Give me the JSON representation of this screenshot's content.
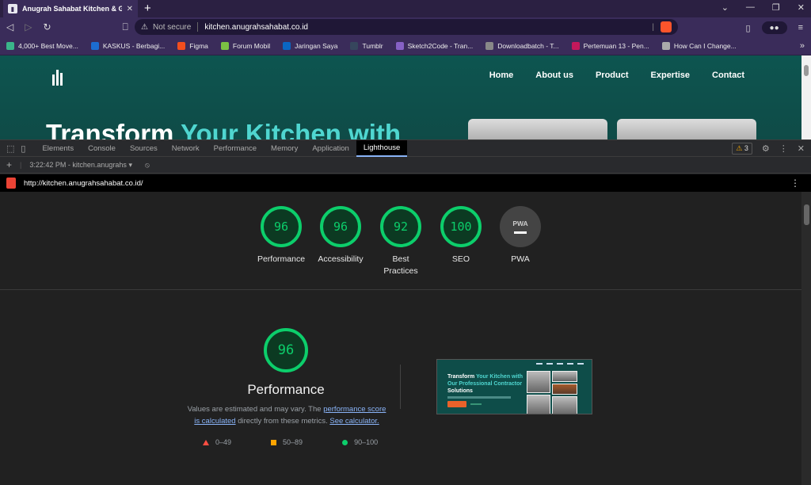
{
  "browser": {
    "tab_title": "Anugrah Sahabat Kitchen & Gas",
    "not_secure": "Not secure",
    "url": "kitchen.anugrahsahabat.co.id",
    "bookmarks": [
      {
        "label": "4,000+ Best Move...",
        "color": "#3ab58a"
      },
      {
        "label": "KASKUS - Berbagi...",
        "color": "#1c6dd0"
      },
      {
        "label": "Figma",
        "color": "#f24e1e"
      },
      {
        "label": "Forum Mobil",
        "color": "#7bc043"
      },
      {
        "label": "Jaringan Saya",
        "color": "#0a66c2"
      },
      {
        "label": "Tumblr",
        "color": "#36465d"
      },
      {
        "label": "Sketch2Code - Tran...",
        "color": "#8661c5"
      },
      {
        "label": "Downloadbatch - T...",
        "color": "#888888"
      },
      {
        "label": "Pertemuan 13 - Pen...",
        "color": "#c2185b"
      },
      {
        "label": "How Can I Change...",
        "color": "#aaaaaa"
      }
    ]
  },
  "site": {
    "nav": [
      "Home",
      "About us",
      "Product",
      "Expertise",
      "Contact"
    ],
    "hero_white": "Transform ",
    "hero_accent": "Your Kitchen with"
  },
  "devtools": {
    "tabs": [
      "Elements",
      "Console",
      "Sources",
      "Network",
      "Performance",
      "Memory",
      "Application",
      "Lighthouse"
    ],
    "active_tab": "Lighthouse",
    "warnings": "3",
    "report_select": "3:22:42 PM - kitchen.anugrahs",
    "report_url": "http://kitchen.anugrahsahabat.co.id/"
  },
  "scores": [
    {
      "score": "96",
      "label": "Performance"
    },
    {
      "score": "96",
      "label": "Accessibility"
    },
    {
      "score": "92",
      "label": "Best Practices"
    },
    {
      "score": "100",
      "label": "SEO"
    }
  ],
  "pwa": {
    "badge": "PWA",
    "label": "PWA"
  },
  "performance": {
    "score": "96",
    "title": "Performance",
    "desc_1": "Values are estimated and may vary. The ",
    "link_1": "performance score is calculated",
    "desc_2": " directly from these metrics. ",
    "link_2": "See calculator.",
    "legend": [
      "0–49",
      "50–89",
      "90–100"
    ]
  },
  "thumbnail": {
    "line1_white": "Transform ",
    "line1_accent": "Your Kitchen with",
    "line2": "Our Professional Contractor",
    "line3": "Solutions"
  }
}
